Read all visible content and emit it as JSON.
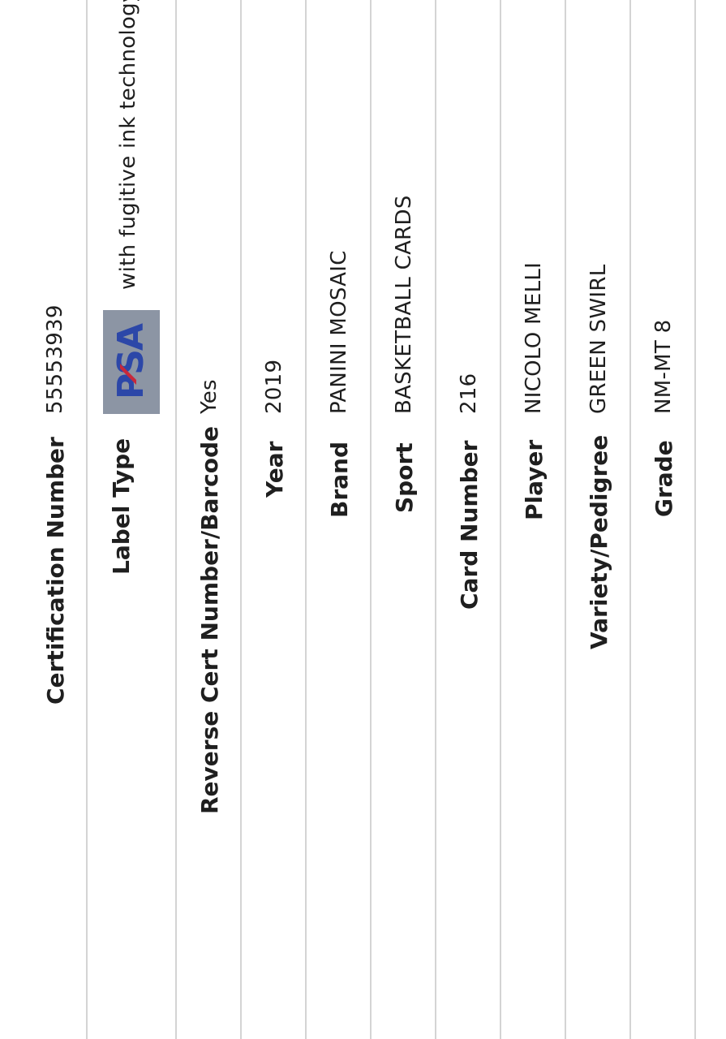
{
  "certification": {
    "label": "Certification Number",
    "value": "55553939"
  },
  "label_type": {
    "label": "Label Type",
    "logo_text": "PSA",
    "value_text": "with fugitive ink technology"
  },
  "reverse_cert": {
    "label": "Reverse Cert Number/Barcode",
    "value": "Yes"
  },
  "year": {
    "label": "Year",
    "value": "2019"
  },
  "brand": {
    "label": "Brand",
    "value": "PANINI MOSAIC"
  },
  "sport": {
    "label": "Sport",
    "value": "BASKETBALL CARDS"
  },
  "card_number": {
    "label": "Card Number",
    "value": "216"
  },
  "player": {
    "label": "Player",
    "value": "NICOLO MELLI"
  },
  "variety": {
    "label": "Variety/Pedigree",
    "value": "GREEN SWIRL"
  },
  "grade": {
    "label": "Grade",
    "value": "NM-MT 8"
  },
  "colors": {
    "divider": "#d4d4d4",
    "psa_blue": "#2c47a8",
    "psa_red": "#c8283a",
    "text": "#1f1f1f"
  }
}
